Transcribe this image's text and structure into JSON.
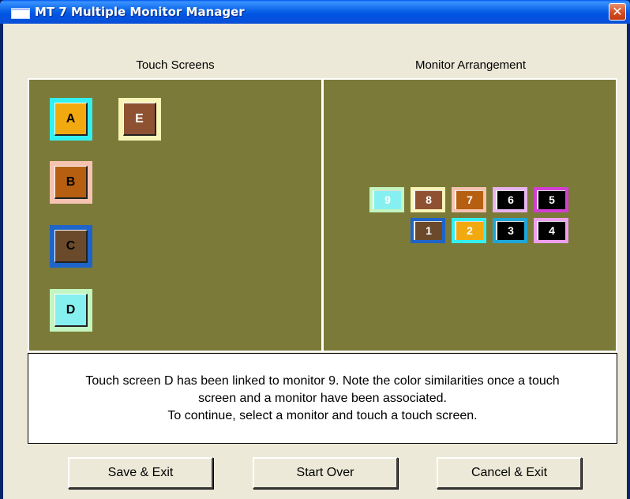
{
  "window": {
    "title": "MT 7 Multiple Monitor Manager",
    "close_glyph": "✕"
  },
  "touch_screens": {
    "title": "Touch Screens",
    "items": [
      {
        "label": "A",
        "fill": "#f2a90f",
        "border": "#33f0f0",
        "text_color": "#000000"
      },
      {
        "label": "E",
        "fill": "#8e5132",
        "border": "#f8f3b6",
        "text_color": "#ffffff"
      },
      {
        "label": "B",
        "fill": "#b65f10",
        "border": "#f6c3b1",
        "text_color": "#000000"
      },
      {
        "label": "C",
        "fill": "#6b4a2b",
        "border": "#1f64c8",
        "text_color": "#000000"
      },
      {
        "label": "D",
        "fill": "#86f0f0",
        "border": "#c2f5c0",
        "text_color": "#000000"
      }
    ]
  },
  "monitor_arrangement": {
    "title": "Monitor Arrangement",
    "monitors": [
      {
        "label": "9",
        "fill": "#86f0f0",
        "border": "#c2f5c0"
      },
      {
        "label": "8",
        "fill": "#8e5132",
        "border": "#f8f3b6"
      },
      {
        "label": "7",
        "fill": "#b65f10",
        "border": "#f6c3b1"
      },
      {
        "label": "6",
        "fill": "#000000",
        "border": "#e7b4ef"
      },
      {
        "label": "5",
        "fill": "#000000",
        "border": "#d23fd2"
      },
      {
        "label": "1",
        "fill": "#6b4a2b",
        "border": "#1f64c8"
      },
      {
        "label": "2",
        "fill": "#f2a90f",
        "border": "#33f0f0"
      },
      {
        "label": "3",
        "fill": "#000000",
        "border": "#1fa6d8"
      },
      {
        "label": "4",
        "fill": "#000000",
        "border": "#ef9fef"
      }
    ]
  },
  "message": {
    "line1": "Touch screen D has been linked to monitor 9. Note the color similarities once a touch",
    "line2": "screen and a monitor have been associated.",
    "line3": "To continue, select a monitor and touch a touch screen."
  },
  "buttons": {
    "save": "Save & Exit",
    "start_over": "Start Over",
    "cancel": "Cancel & Exit"
  },
  "colors": {
    "panel_background": "#7b7a39",
    "dialog_background": "#ece9d8",
    "titlebar": "#0054e3"
  }
}
